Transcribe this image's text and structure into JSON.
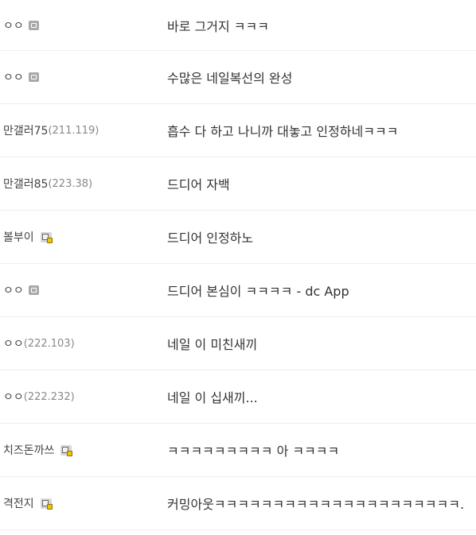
{
  "comments": [
    {
      "nick": "ㅇㅇ",
      "ip": "",
      "badge": "gray",
      "text": "바로 그거지 ㅋㅋㅋ"
    },
    {
      "nick": "ㅇㅇ",
      "ip": "",
      "badge": "gray",
      "text": "수많은 네일복선의 완성"
    },
    {
      "nick": "만갤러75",
      "ip": "(211.119)",
      "badge": "none",
      "text": "흡수 다 하고 나니까 대놓고 인정하네ㅋㅋㅋ"
    },
    {
      "nick": "만갤러85",
      "ip": "(223.38)",
      "badge": "none",
      "text": "드디어 자백"
    },
    {
      "nick": "볼부이",
      "ip": "",
      "badge": "fixed",
      "text": "드디어 인정하노"
    },
    {
      "nick": "ㅇㅇ",
      "ip": "",
      "badge": "gray",
      "text": "드디어 본심이 ㅋㅋㅋㅋ - dc App"
    },
    {
      "nick": "ㅇㅇ",
      "ip": "(222.103)",
      "badge": "none",
      "text": "네일 이 미친새끼"
    },
    {
      "nick": "ㅇㅇ",
      "ip": "(222.232)",
      "badge": "none",
      "text": "네일 이 십새끼..."
    },
    {
      "nick": "치즈돈까쓰",
      "ip": "",
      "badge": "fixed",
      "text": "ㅋㅋㅋㅋㅋㅋㅋㅋㅋ 아 ㅋㅋㅋㅋ"
    },
    {
      "nick": "격전지",
      "ip": "",
      "badge": "fixed",
      "text": "커밍아웃ㅋㅋㅋㅋㅋㅋㅋㅋㅋㅋㅋㅋㅋㅋㅋㅋㅋㅋㅋㅋㅋ."
    }
  ],
  "icons": {
    "gray": "gallery-member-icon",
    "fixed": "fixed-nick-icon"
  },
  "colors": {
    "text": "#333333",
    "ip": "#888888",
    "divider": "#eeeeee",
    "fixed_badge": "#f0c400"
  }
}
